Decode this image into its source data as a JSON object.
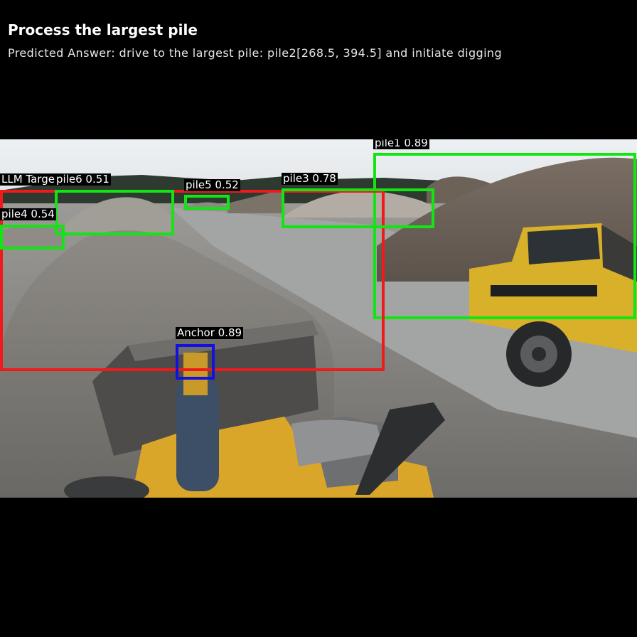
{
  "header": {
    "title": "Process the largest pile",
    "predicted_answer": "Predicted Answer: drive to the largest pile: pile2[268.5, 394.5] and initiate digging"
  },
  "colors": {
    "pile_box": "#12e612",
    "target_box": "#ef1b1b",
    "anchor_box": "#1212e0"
  },
  "detections": [
    {
      "id": "pile1",
      "label": "pile1 0.89"
    },
    {
      "id": "target",
      "label": "LLM Target 0.84"
    },
    {
      "id": "pile6",
      "label": "pile6 0.51"
    },
    {
      "id": "pile5",
      "label": "pile5 0.52"
    },
    {
      "id": "pile3",
      "label": "pile3 0.78"
    },
    {
      "id": "pile4",
      "label": "pile4 0.54"
    },
    {
      "id": "anchor",
      "label": "Anchor 0.89"
    }
  ]
}
